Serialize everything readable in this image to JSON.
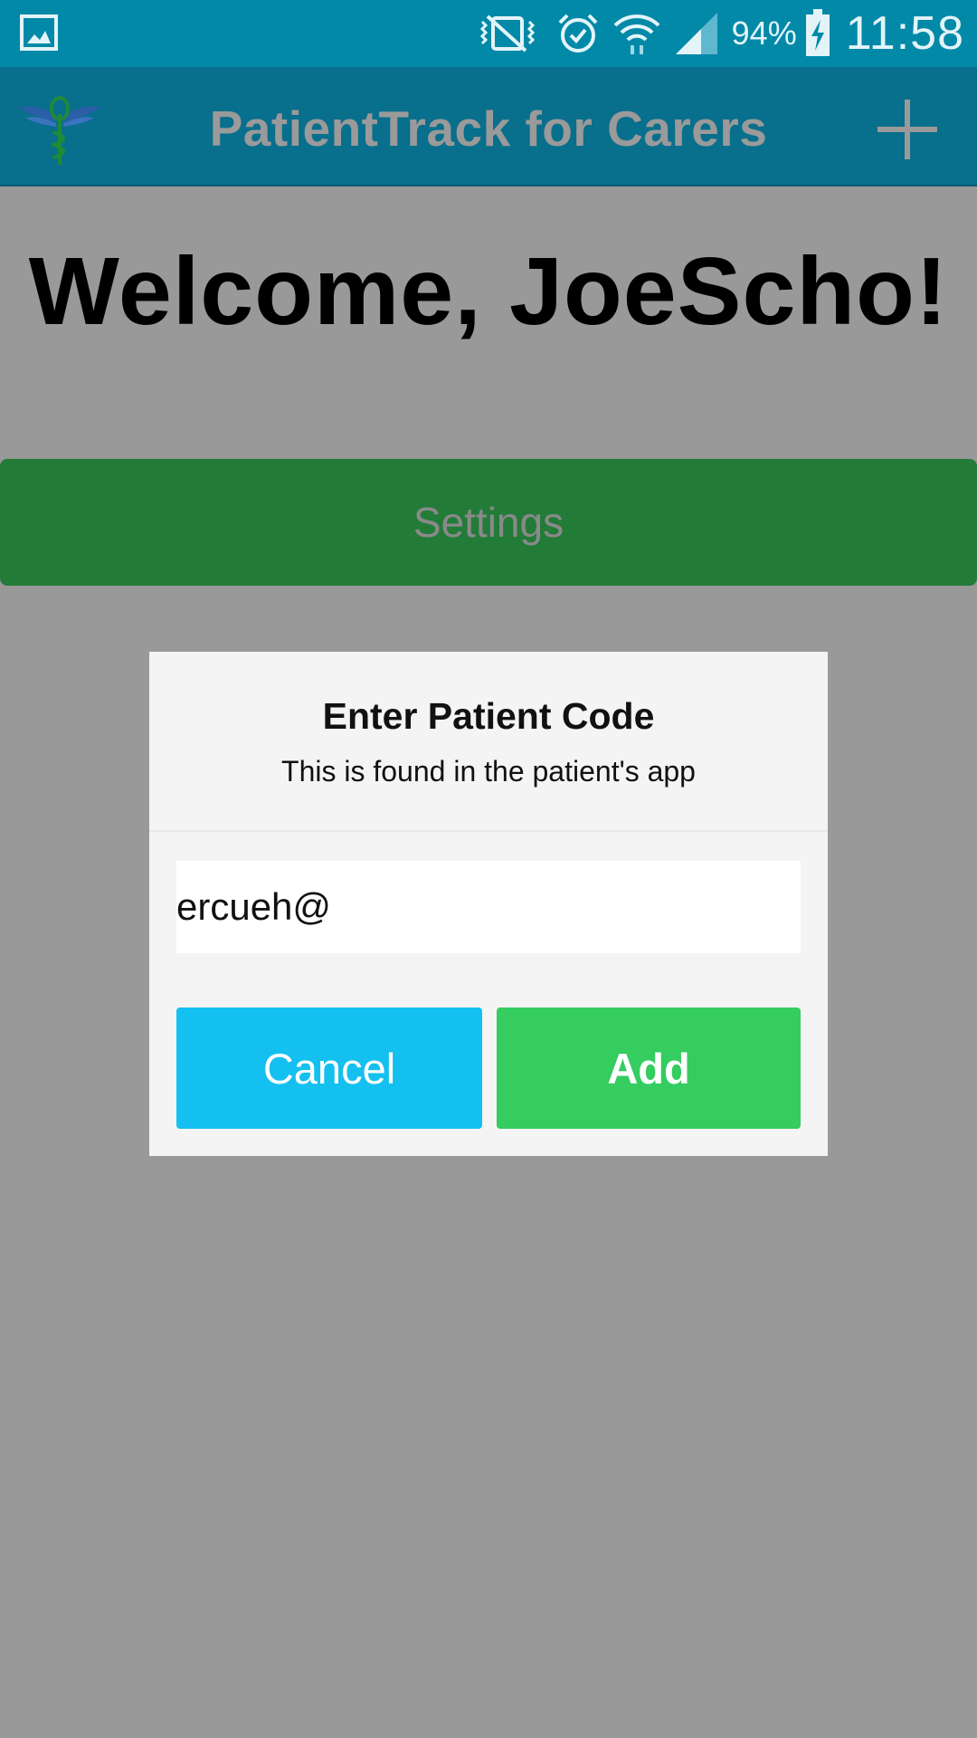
{
  "status_bar": {
    "battery_percent": "94%",
    "time": "11:58"
  },
  "app_bar": {
    "title": "PatientTrack for Carers",
    "logo_icon": "caduceus-logo-icon",
    "add_icon": "plus-icon"
  },
  "main": {
    "welcome_text": "Welcome, JoeScho!",
    "settings_label": "Settings"
  },
  "dialog": {
    "title": "Enter Patient Code",
    "subtitle": "This is found in the patient's app",
    "input_value": "ercueh@",
    "cancel_label": "Cancel",
    "add_label": "Add"
  },
  "colors": {
    "status_bar": "#0289a8",
    "app_bar": "#086f8c",
    "overlay_background": "#999999",
    "settings_green": "#237b38",
    "cancel_blue": "#14c0f0",
    "add_green": "#35cc60"
  }
}
